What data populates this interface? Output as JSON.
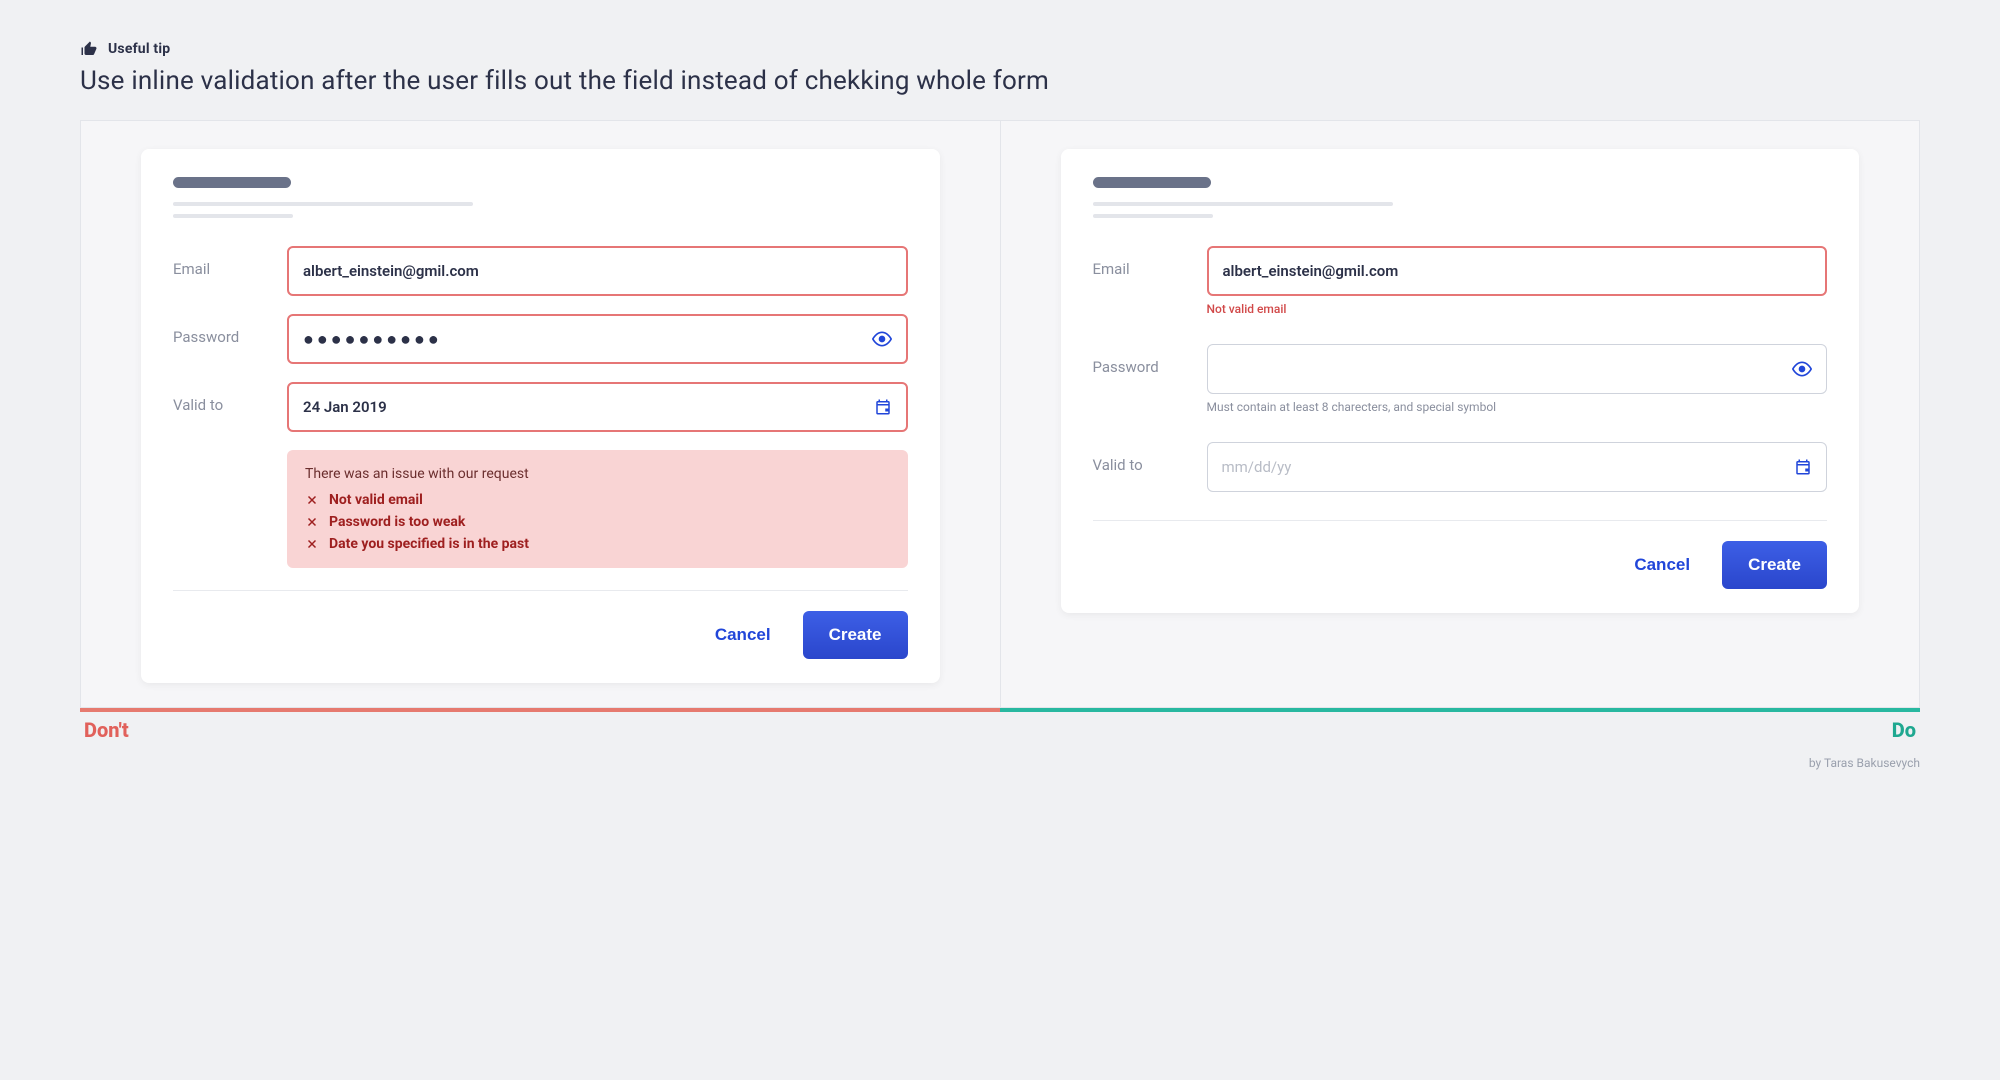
{
  "tip": {
    "label": "Useful tip",
    "title": "Use inline validation after the user fills out the field instead of chekking whole form"
  },
  "dont": {
    "labels": {
      "email": "Email",
      "password": "Password",
      "validTo": "Valid to"
    },
    "values": {
      "email": "albert_einstein@gmil.com",
      "password": "●●●●●●●●●●",
      "validTo": "24 Jan 2019"
    },
    "error": {
      "title": "There was an issue with our request",
      "items": [
        "Not valid email",
        "Password is too weak",
        "Date you specified is in the past"
      ]
    },
    "actions": {
      "cancel": "Cancel",
      "create": "Create"
    },
    "panelLabel": "Don't"
  },
  "do": {
    "labels": {
      "email": "Email",
      "password": "Password",
      "validTo": "Valid to"
    },
    "values": {
      "email": "albert_einstein@gmil.com",
      "emailHelper": "Not valid email",
      "passwordHelper": "Must contain at least 8 charecters, and special symbol",
      "validToPlaceholder": "mm/dd/yy"
    },
    "actions": {
      "cancel": "Cancel",
      "create": "Create"
    },
    "panelLabel": "Do"
  },
  "credit": "by Taras Bakusevych"
}
